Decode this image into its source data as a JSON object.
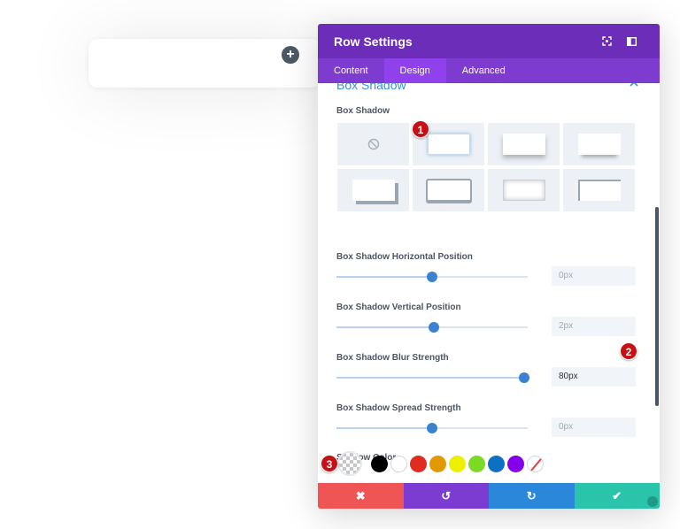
{
  "modal": {
    "title": "Row Settings",
    "tabs": [
      {
        "label": "Content",
        "active": false
      },
      {
        "label": "Design",
        "active": true
      },
      {
        "label": "Advanced",
        "active": false
      }
    ],
    "header_icons": [
      "fullscreen-icon",
      "sidebar-icon"
    ]
  },
  "section": {
    "title": "Box Shadow",
    "toggle_icon": "chevron-up-icon"
  },
  "box_shadow": {
    "label": "Box Shadow",
    "selected_preset": 1
  },
  "sliders": [
    {
      "label": "Box Shadow Horizontal Position",
      "value": "0px",
      "fraction": 0.5
    },
    {
      "label": "Box Shadow Vertical Position",
      "value": "2px",
      "fraction": 0.51
    },
    {
      "label": "Box Shadow Blur Strength",
      "value": "80px",
      "fraction": 0.98
    },
    {
      "label": "Box Shadow Spread Strength",
      "value": "0px",
      "fraction": 0.5
    }
  ],
  "shadow_color": {
    "label": "Shadow Color",
    "swatches": [
      "#000000",
      "#ffffff",
      "#e02b20",
      "#e09900",
      "#edf000",
      "#7cda24",
      "#0c71c3",
      "#8300e9",
      "none"
    ]
  },
  "badges": [
    "1",
    "2",
    "3"
  ],
  "footer": {
    "cancel": "✖",
    "undo": "↺",
    "redo": "↻",
    "save": "✔"
  },
  "colors": {
    "header": "#6c2eb9",
    "accent": "#3a8ddb",
    "cancel": "#ef5555",
    "undo": "#7c3bd1",
    "redo": "#2b87da",
    "save": "#29c4a9"
  }
}
